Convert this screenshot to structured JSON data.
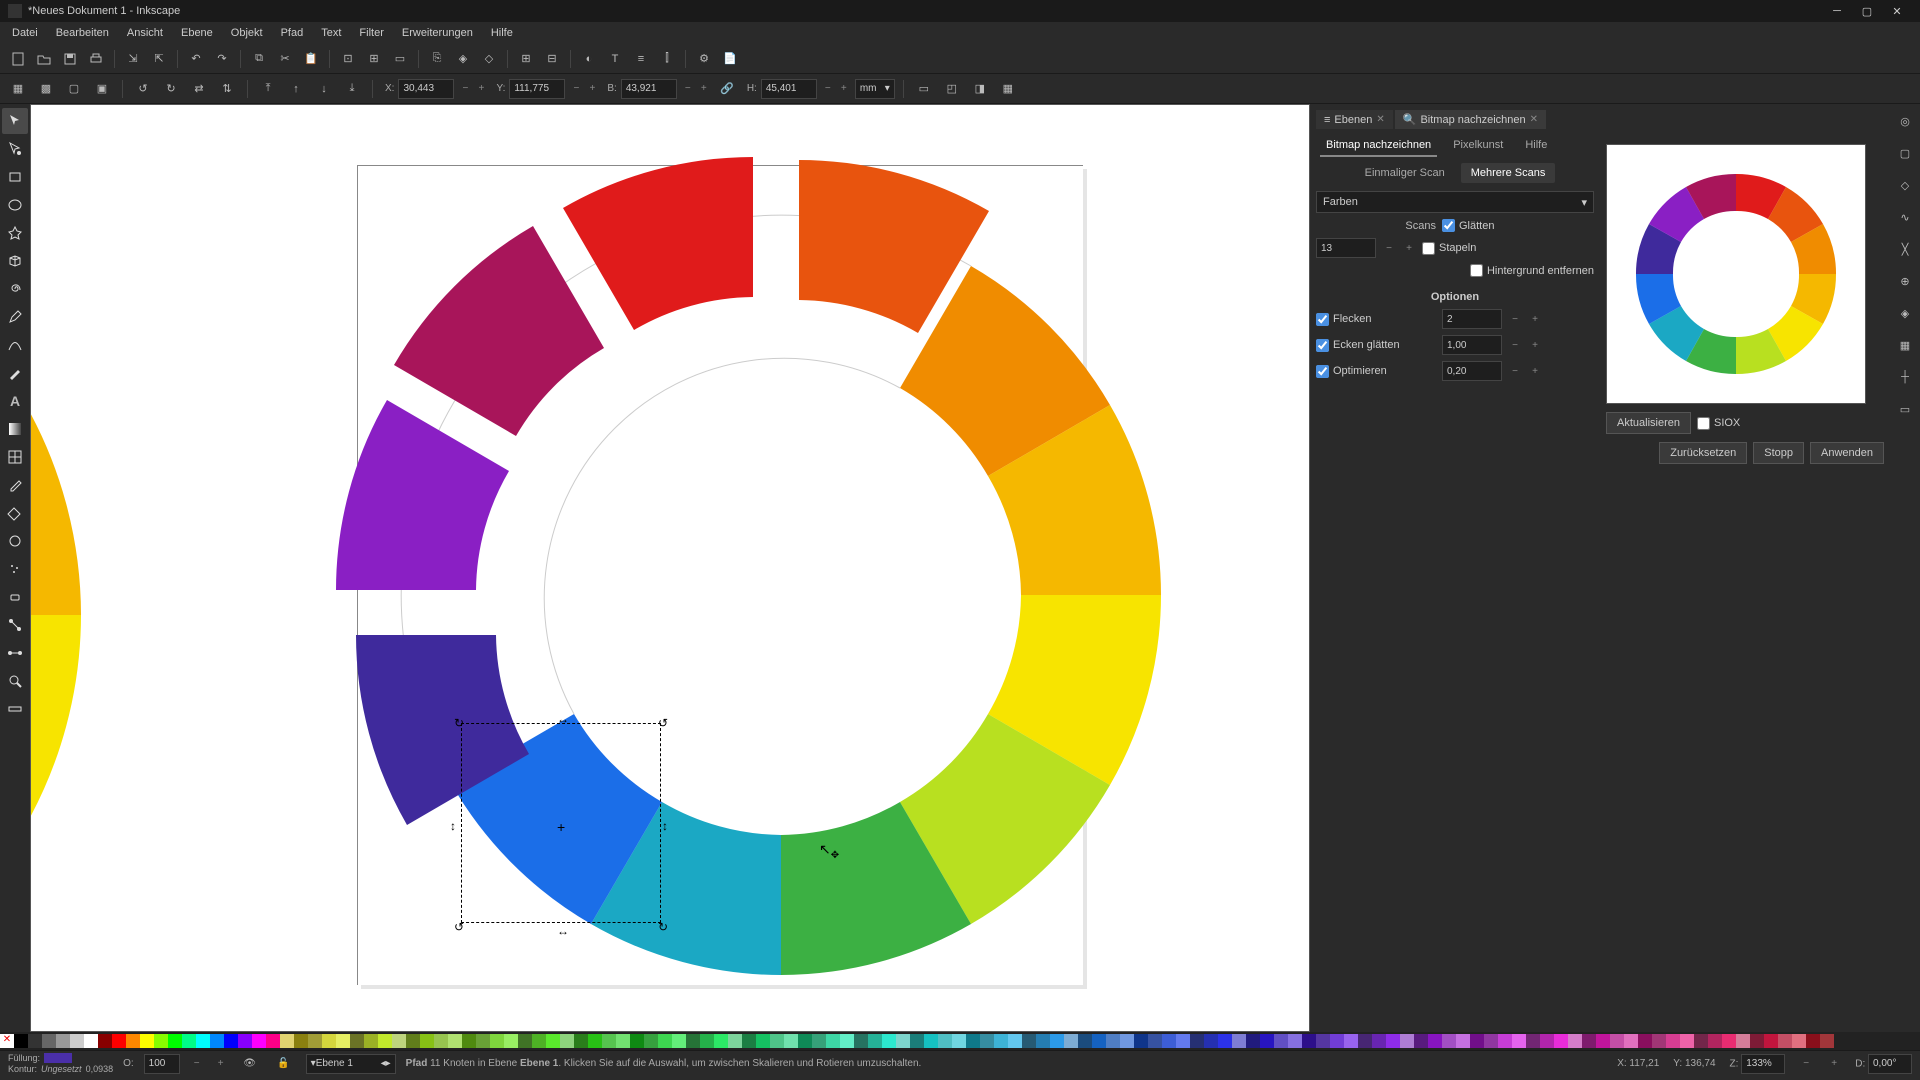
{
  "window": {
    "title": "*Neues Dokument 1 - Inkscape"
  },
  "menu": [
    "Datei",
    "Bearbeiten",
    "Ansicht",
    "Ebene",
    "Objekt",
    "Pfad",
    "Text",
    "Filter",
    "Erweiterungen",
    "Hilfe"
  ],
  "coords": {
    "x_label": "X:",
    "x": "30,443",
    "y_label": "Y:",
    "y": "111,775",
    "w_label": "B:",
    "w": "43,921",
    "h_label": "H:",
    "h": "45,401",
    "unit": "mm"
  },
  "panel": {
    "tabs": {
      "layers": "Ebenen",
      "trace": "Bitmap nachzeichnen"
    },
    "subtabs": {
      "trace": "Bitmap nachzeichnen",
      "pixelart": "Pixelkunst",
      "help": "Hilfe"
    },
    "scantabs": {
      "single": "Einmaliger Scan",
      "multi": "Mehrere Scans"
    },
    "mode": "Farben",
    "scans_label": "Scans",
    "scans_value": "13",
    "smooth": "Glätten",
    "stack": "Stapeln",
    "removebg": "Hintergrund entfernen",
    "options": "Optionen",
    "speckles": "Flecken",
    "speckles_val": "2",
    "corners": "Ecken glätten",
    "corners_val": "1,00",
    "optimize": "Optimieren",
    "optimize_val": "0,20",
    "update": "Aktualisieren",
    "siox": "SIOX",
    "reset": "Zurücksetzen",
    "stop": "Stopp",
    "apply": "Anwenden"
  },
  "status": {
    "fill_label": "Füllung:",
    "stroke_label": "Kontur:",
    "stroke_val": "Ungesetzt",
    "stroke_w": "0,0938",
    "opacity_label": "O:",
    "opacity": "100",
    "layer": "Ebene 1",
    "msg_prefix": "Pfad",
    "msg_mid": "11 Knoten in Ebene",
    "msg_layer": "Ebene 1",
    "msg_suffix": ". Klicken Sie auf die Auswahl, um zwischen Skalieren und Rotieren umzuschalten.",
    "cursor_x_label": "X:",
    "cursor_x": "117,21",
    "cursor_y_label": "Y:",
    "cursor_y": "136,74",
    "zoom_label": "Z:",
    "zoom": "133%",
    "rot_label": "D:",
    "rot": "0,00°"
  },
  "palette_none": "✕"
}
